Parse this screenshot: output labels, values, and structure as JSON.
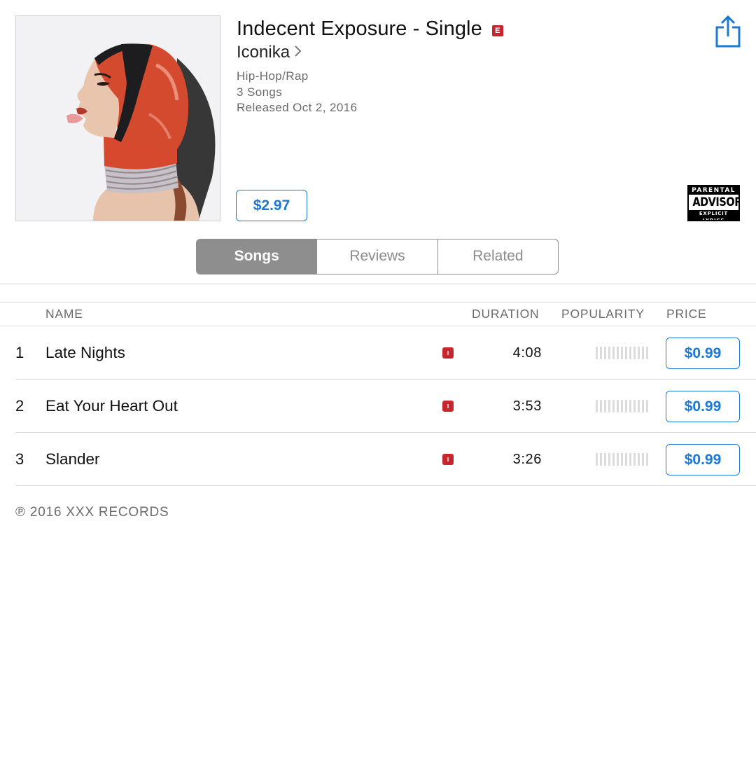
{
  "album": {
    "title": "Indecent Exposure - Single",
    "explicit_badge": "E",
    "artist": "Iconika",
    "genre": "Hip-Hop/Rap",
    "song_count": "3 Songs",
    "released": "Released Oct 2, 2016",
    "price": "$2.97",
    "advisory": {
      "top": "PARENTAL",
      "middle": "ADVISORY",
      "bottom": "EXPLICIT LYRICS"
    }
  },
  "tabs": [
    {
      "label": "Songs",
      "active": true
    },
    {
      "label": "Reviews",
      "active": false
    },
    {
      "label": "Related",
      "active": false
    }
  ],
  "table": {
    "headers": {
      "name": "NAME",
      "duration": "DURATION",
      "popularity": "POPULARITY",
      "price": "PRICE"
    },
    "rows": [
      {
        "number": "1",
        "name": "Late Nights",
        "explicit": true,
        "duration": "4:08",
        "price": "$0.99"
      },
      {
        "number": "2",
        "name": "Eat Your Heart Out",
        "explicit": true,
        "duration": "3:53",
        "price": "$0.99"
      },
      {
        "number": "3",
        "name": "Slander",
        "explicit": true,
        "duration": "3:26",
        "price": "$0.99"
      }
    ]
  },
  "footer": {
    "copyright": "℗ 2016 XXX RECORDS"
  },
  "icons": {
    "share": "share-icon",
    "artist_chevron": "chevron-right-icon",
    "explicit": "explicit-icon"
  },
  "colors": {
    "accent": "#1b78d4",
    "explicit": "#c6262e",
    "segment_active": "#8e8e8e"
  }
}
